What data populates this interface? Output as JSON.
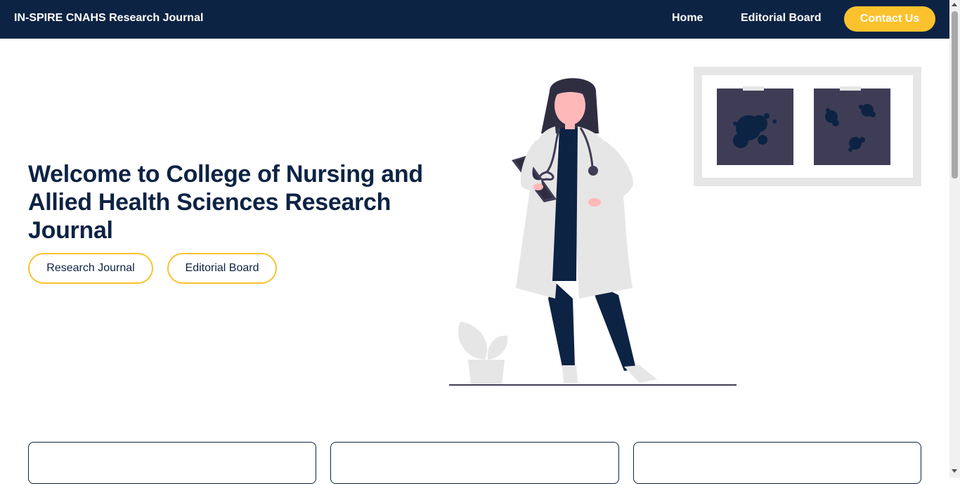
{
  "navbar": {
    "brand": "IN-SPIRE CNAHS Research Journal",
    "links": [
      {
        "label": "Home"
      },
      {
        "label": "Editorial Board"
      }
    ],
    "contact_label": "Contact Us"
  },
  "hero": {
    "title": "Welcome to College of Nursing and Allied Health Sciences Research Journal",
    "buttons": [
      {
        "label": "Research Journal"
      },
      {
        "label": "Editorial Board"
      }
    ],
    "illustration": "doctor-with-clipboard-and-xray-illustration"
  },
  "colors": {
    "navy": "#0d2344",
    "accent": "#fbc22e",
    "illustration_gray": "#e6e6e6",
    "xray_dark": "#3f3d56"
  },
  "cards": [
    {
      "name": "card-1"
    },
    {
      "name": "card-2"
    },
    {
      "name": "card-3"
    }
  ]
}
